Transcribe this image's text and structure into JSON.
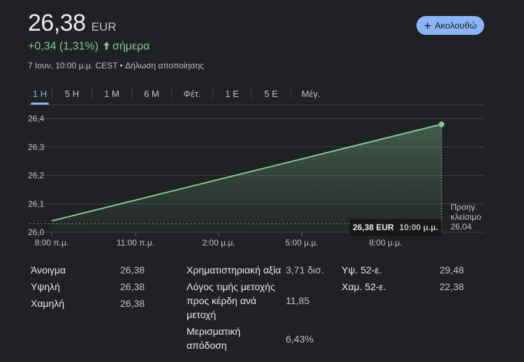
{
  "quote": {
    "price": "26,38",
    "currency": "EUR",
    "change": "+0,34 (1,31%)",
    "change_period": "σήμερα",
    "meta": "7 Ιουν, 10:00 μ.μ. CEST • Δήλωση αποποίησης",
    "follow_label": "Ακολουθώ",
    "accent_color": "#8ab4f8",
    "up_color": "#81c995"
  },
  "tabs": [
    {
      "label": "1 Η",
      "active": true
    },
    {
      "label": "5 Η",
      "active": false
    },
    {
      "label": "1 Μ",
      "active": false
    },
    {
      "label": "6 Μ",
      "active": false
    },
    {
      "label": "Φέτ.",
      "active": false
    },
    {
      "label": "1 Ε",
      "active": false
    },
    {
      "label": "5 Ε",
      "active": false
    },
    {
      "label": "Μέγ.",
      "active": false
    }
  ],
  "chart_data": {
    "type": "area",
    "x": [
      "8:00 π.μ.",
      "10:00 μ.μ."
    ],
    "values": [
      26.04,
      26.38
    ],
    "ylim": [
      26.0,
      26.4
    ],
    "y_ticks": [
      "26,0",
      "26,1",
      "26,2",
      "26,3",
      "26,4"
    ],
    "x_ticks": [
      "8:00 π.μ.",
      "11:00 π.μ.",
      "2:00 μ.μ.",
      "5:00 μ.μ.",
      "8:00 μ.μ."
    ],
    "previous_close": 26.04,
    "previous_close_label_1": "Προηγ.",
    "previous_close_label_2": "κλείσιμο",
    "previous_close_value": "26,04",
    "tooltip_price": "26,38 EUR",
    "tooltip_time": "10:00 μ.μ.",
    "grid": true,
    "line_color": "#81c995"
  },
  "stats": {
    "open_label": "Άνοιγμα",
    "open_value": "26,38",
    "high_label": "Υψηλή",
    "high_value": "26,38",
    "low_label": "Χαμηλή",
    "low_value": "26,38",
    "mktcap_label": "Χρηματιστηριακή αξία",
    "mktcap_value": "3,71 δισ.",
    "pe_label_1": "Λόγος τιμής μετοχής",
    "pe_label_2": "προς κέρδη ανά",
    "pe_label_3": "μετοχή",
    "pe_value": "11,85",
    "div_label_1": "Μερισματική",
    "div_label_2": "απόδοση",
    "div_value": "6,43%",
    "high52_label": "Υψ. 52-ε.",
    "high52_value": "29,48",
    "low52_label": "Χαμ. 52-ε.",
    "low52_value": "22,38"
  }
}
